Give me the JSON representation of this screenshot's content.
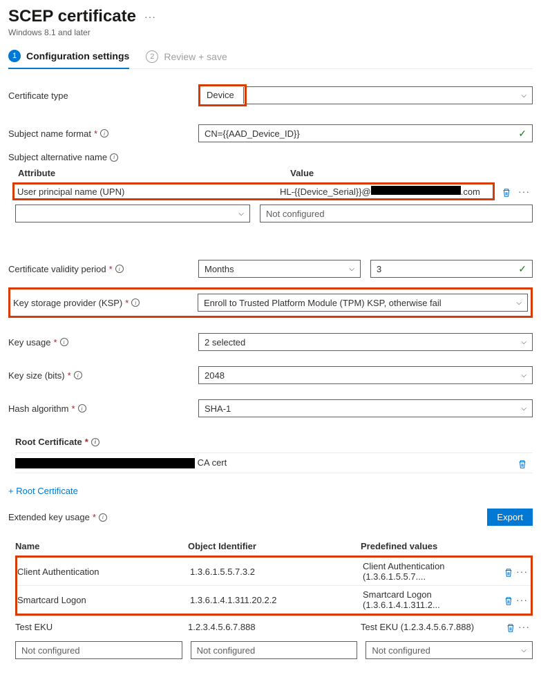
{
  "header": {
    "title": "SCEP certificate",
    "subtitle": "Windows 8.1 and later"
  },
  "tabs": {
    "step1_num": "1",
    "step1_label": "Configuration settings",
    "step2_num": "2",
    "step2_label": "Review + save"
  },
  "fields": {
    "cert_type_label": "Certificate type",
    "cert_type_value": "Device",
    "subj_name_label": "Subject name format",
    "subj_name_value": "CN={{AAD_Device_ID}}",
    "san_label": "Subject alternative name",
    "san_attr_header": "Attribute",
    "san_val_header": "Value",
    "san_attr": "User principal name (UPN)",
    "san_val_prefix": "HL-{{Device_Serial}}@",
    "san_val_suffix": ".com",
    "not_configured": "Not configured",
    "validity_label": "Certificate validity period",
    "validity_unit": "Months",
    "validity_value": "3",
    "ksp_label": "Key storage provider (KSP)",
    "ksp_value": "Enroll to Trusted Platform Module (TPM) KSP, otherwise fail",
    "key_usage_label": "Key usage",
    "key_usage_value": "2 selected",
    "key_size_label": "Key size (bits)",
    "key_size_value": "2048",
    "hash_label": "Hash algorithm",
    "hash_value": "SHA-1",
    "root_label": "Root Certificate",
    "root_cert_suffix": "CA cert",
    "root_add": "+ Root Certificate",
    "eku_label": "Extended key usage",
    "export_btn": "Export",
    "eku_h1": "Name",
    "eku_h2": "Object Identifier",
    "eku_h3": "Predefined values",
    "eku_rows": [
      {
        "name": "Client Authentication",
        "oid": "1.3.6.1.5.5.7.3.2",
        "pred": "Client Authentication (1.3.6.1.5.5.7...."
      },
      {
        "name": "Smartcard Logon",
        "oid": "1.3.6.1.4.1.311.20.2.2",
        "pred": "Smartcard Logon (1.3.6.1.4.1.311.2..."
      },
      {
        "name": "Test EKU",
        "oid": "1.2.3.4.5.6.7.888",
        "pred": "Test EKU (1.2.3.4.5.6.7.888)"
      }
    ]
  }
}
